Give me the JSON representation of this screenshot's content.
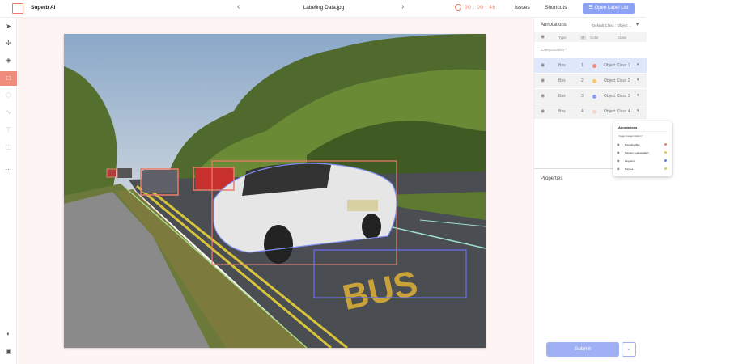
{
  "header": {
    "app_name": "Superb AI",
    "prev_icon": "chevron-left-icon",
    "file_name": "Labeling Data.jpg",
    "next_icon": "chevron-right-icon",
    "timer": "00 : 00 : 46",
    "issues_label": "Issues",
    "shortcuts_label": "Shortcuts",
    "open_label_list": "Open Label List"
  },
  "toolbar": {
    "tools": [
      "cursor-icon",
      "move-icon",
      "fill-icon",
      "bounding-box-icon",
      "polygon-icon",
      "polyline-icon",
      "keypoint-icon",
      "cuboid-icon",
      "more-icon"
    ],
    "bottom_tools": [
      "contrast-icon",
      "fit-screen-icon"
    ],
    "accent_color": "#ef8c7c"
  },
  "annotations": {
    "title": "Annotations",
    "default_class": "Default Class : Object ...",
    "columns": {
      "type": "Type",
      "number": "#",
      "color": "Color",
      "class": "Class"
    },
    "category_label": "Categorization *",
    "rows": [
      {
        "type": "Box",
        "number": "1",
        "class": "Object Class 1",
        "color": "#ef8c7c",
        "selected": true
      },
      {
        "type": "Box",
        "number": "2",
        "class": "Object Class 2",
        "color": "#f1c96e",
        "selected": false
      },
      {
        "type": "Box",
        "number": "3",
        "class": "Object Class 3",
        "color": "#8ea2f5",
        "selected": false
      },
      {
        "type": "Box",
        "number": "4",
        "class": "Object Class 4",
        "color": "#f3d3cc",
        "selected": false
      }
    ]
  },
  "properties": {
    "title": "Properties"
  },
  "submit": {
    "label": "Submit",
    "caret_icon": "chevron-down-icon"
  },
  "popup": {
    "title": "Annotations",
    "subtitle": "Image Categorization *",
    "items": [
      {
        "label": "Bounding Box",
        "color": "#ef7c6b"
      },
      {
        "label": "Polygon segmentation",
        "color": "#f1c24e"
      },
      {
        "label": "Keypoint",
        "color": "#6b7ff0"
      },
      {
        "label": "Polyline",
        "color": "#c8d84a"
      }
    ]
  },
  "image": {
    "description_icon": "road-scene-photo",
    "bus_text": "BUS"
  }
}
